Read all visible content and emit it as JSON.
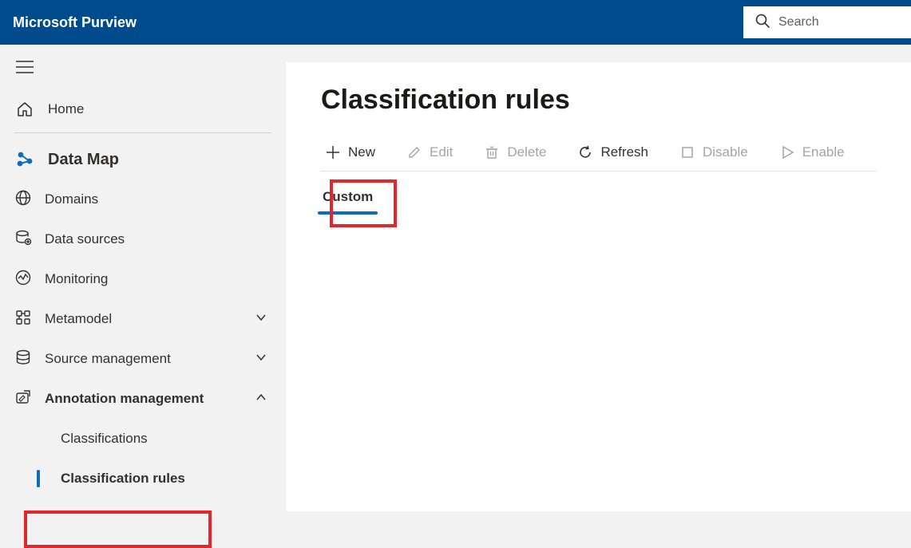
{
  "brand": "Microsoft Purview",
  "search": {
    "placeholder": "Search"
  },
  "sidebar": {
    "home": "Home",
    "section": "Data Map",
    "items": [
      {
        "label": "Domains"
      },
      {
        "label": "Data sources"
      },
      {
        "label": "Monitoring"
      },
      {
        "label": "Metamodel"
      },
      {
        "label": "Source management"
      },
      {
        "label": "Annotation management"
      }
    ],
    "sub": [
      {
        "label": "Classifications"
      },
      {
        "label": "Classification rules"
      }
    ]
  },
  "main": {
    "title": "Classification rules",
    "toolbar": {
      "new": "New",
      "edit": "Edit",
      "delete": "Delete",
      "refresh": "Refresh",
      "disable": "Disable",
      "enable": "Enable"
    },
    "tabs": [
      {
        "label": "Custom"
      }
    ]
  }
}
